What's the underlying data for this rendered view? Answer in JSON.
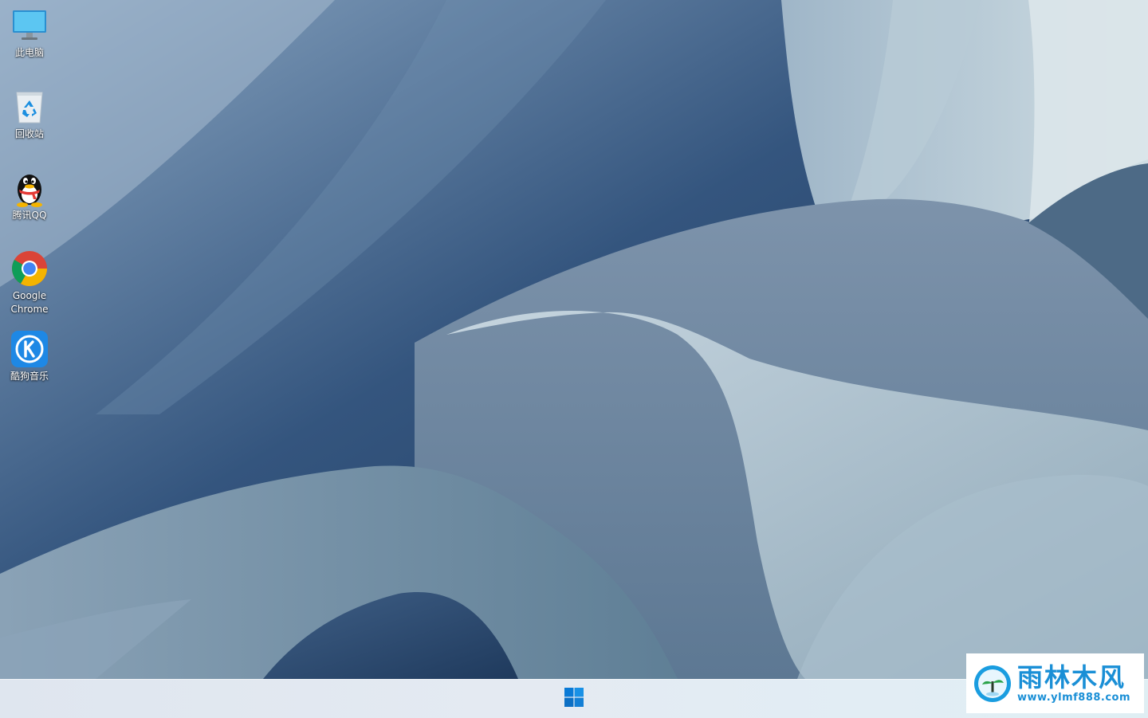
{
  "desktop": {
    "icons": [
      {
        "label": "此电脑",
        "icon": "this-pc-icon"
      },
      {
        "label": "回收站",
        "icon": "recycle-bin-icon"
      },
      {
        "label": "腾讯QQ",
        "icon": "qq-icon"
      },
      {
        "label": "Google\nChrome",
        "icon": "chrome-icon"
      },
      {
        "label": "酷狗音乐",
        "icon": "kugou-icon"
      }
    ]
  },
  "taskbar": {
    "start_icon": "windows-start-icon"
  },
  "watermark": {
    "title": "雨林木风",
    "url": "www.ylmf888.com"
  },
  "colors": {
    "start_blue": "#0078d4",
    "watermark_blue": "#1a8fd6",
    "chrome_red": "#db4437",
    "chrome_yellow": "#f4b400",
    "chrome_green": "#0f9d58",
    "kugou_blue": "#1e88e5"
  }
}
